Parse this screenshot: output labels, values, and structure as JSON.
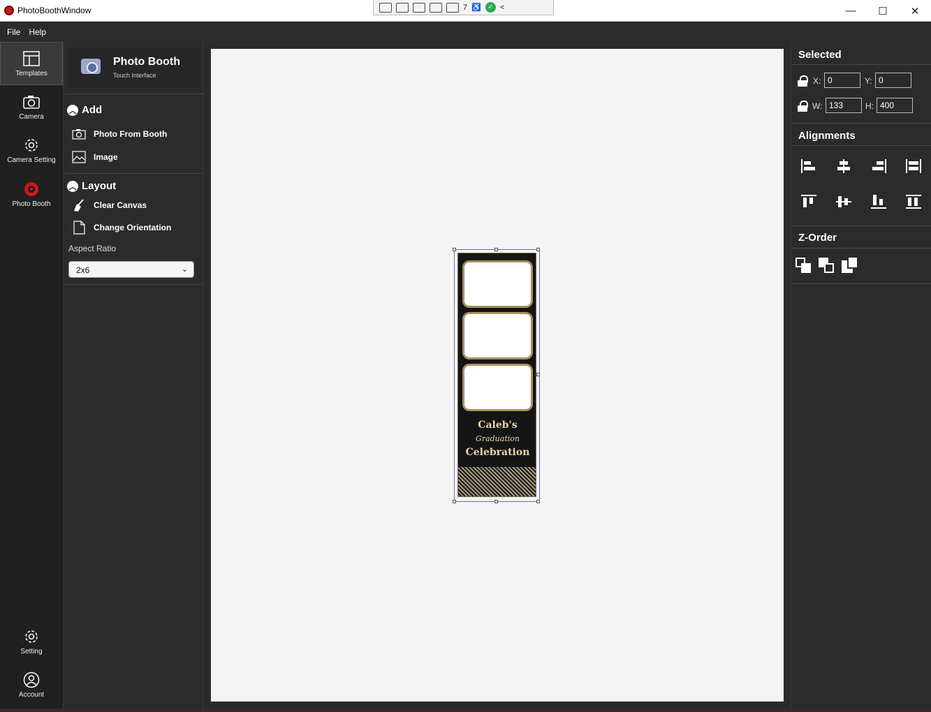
{
  "window": {
    "title": "PhotoBoothWindow",
    "controls": {
      "minimize": "—",
      "maximize": "☐",
      "close": "✕"
    }
  },
  "debug_toolbar": {
    "counter": "7",
    "collapse": "<"
  },
  "menu": [
    "File",
    "Help"
  ],
  "nav": {
    "templates": "Templates",
    "camera": "Camera",
    "camera_setting": "Camera Setting",
    "photo_booth": "Photo Booth",
    "setting": "Setting",
    "account": "Account"
  },
  "brand": {
    "name": "Photo Booth",
    "subtitle": "Touch Interface"
  },
  "add": {
    "header": "Add",
    "photo_from_booth": "Photo From Booth",
    "image": "Image"
  },
  "layout": {
    "header": "Layout",
    "clear_canvas": "Clear Canvas",
    "change_orientation": "Change Orientation",
    "aspect_ratio_label": "Aspect Ratio",
    "aspect_ratio_value": "2x6"
  },
  "template": {
    "line1": "Caleb's",
    "line2": "Graduation",
    "line3": "Celebration"
  },
  "selected": {
    "header": "Selected",
    "x_label": "X:",
    "x": "0",
    "y_label": "Y:",
    "y": "0",
    "w_label": "W:",
    "w": "133",
    "h_label": "H:",
    "h": "400"
  },
  "alignments": {
    "header": "Alignments"
  },
  "zorder": {
    "header": "Z-Order"
  }
}
